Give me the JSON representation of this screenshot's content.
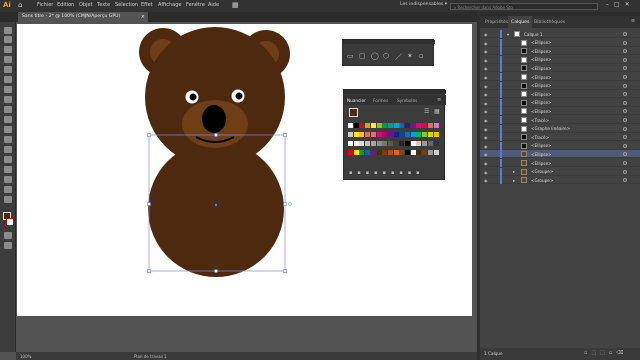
{
  "app": {
    "logo": "Ai",
    "home_icon": "home-icon"
  },
  "menu": [
    "Fichier",
    "Edition",
    "Objet",
    "Texte",
    "Sélection",
    "Effet",
    "Affichage",
    "Fenêtre",
    "Aide"
  ],
  "workspace": {
    "label": "Les indispensables",
    "dropdown_icon": "chevron-down-icon"
  },
  "search": {
    "placeholder": "Rechercher dans Adobe Sto"
  },
  "window_controls": {
    "min": "–",
    "max": "□",
    "close": "✕"
  },
  "document": {
    "tab_title": "Sans titre - 2* @ 100% (CMJN/Aperçu GPU)",
    "close": "×"
  },
  "status": {
    "zoom": "100%",
    "artboard_label": "Plan de travail 1"
  },
  "layers_panel": {
    "tabs": [
      "Propriétés",
      "Calques",
      "Bibliothèques"
    ],
    "active_tab": "Calques",
    "rows": [
      {
        "name": "Calque 1"
      },
      {
        "name": "<Ellipse>"
      },
      {
        "name": "<Ellipse>"
      },
      {
        "name": "<Ellipse>"
      },
      {
        "name": "<Ellipse>"
      },
      {
        "name": "<Ellipse>"
      },
      {
        "name": "<Ellipse>"
      },
      {
        "name": "<Ellipse>"
      },
      {
        "name": "<Ellipse>"
      },
      {
        "name": "<Ellipse>"
      },
      {
        "name": "<Tracé>"
      },
      {
        "name": "<Graphe linéaire>"
      },
      {
        "name": "<Tracé>"
      },
      {
        "name": "<Ellipse>"
      },
      {
        "name": "<Ellipse>"
      },
      {
        "name": "<Ellipse>"
      },
      {
        "name": "<Groupe>"
      },
      {
        "name": "<Groupe>"
      }
    ],
    "bottom_label": "1 Calque"
  },
  "swatch_panel": {
    "tabs": [
      "Nuancier",
      "Formes",
      "Symboles"
    ]
  },
  "colors": {
    "bear_dark": "#4d2a0f",
    "bear_light": "#6e3f16",
    "accent": "#5a7cd6"
  }
}
